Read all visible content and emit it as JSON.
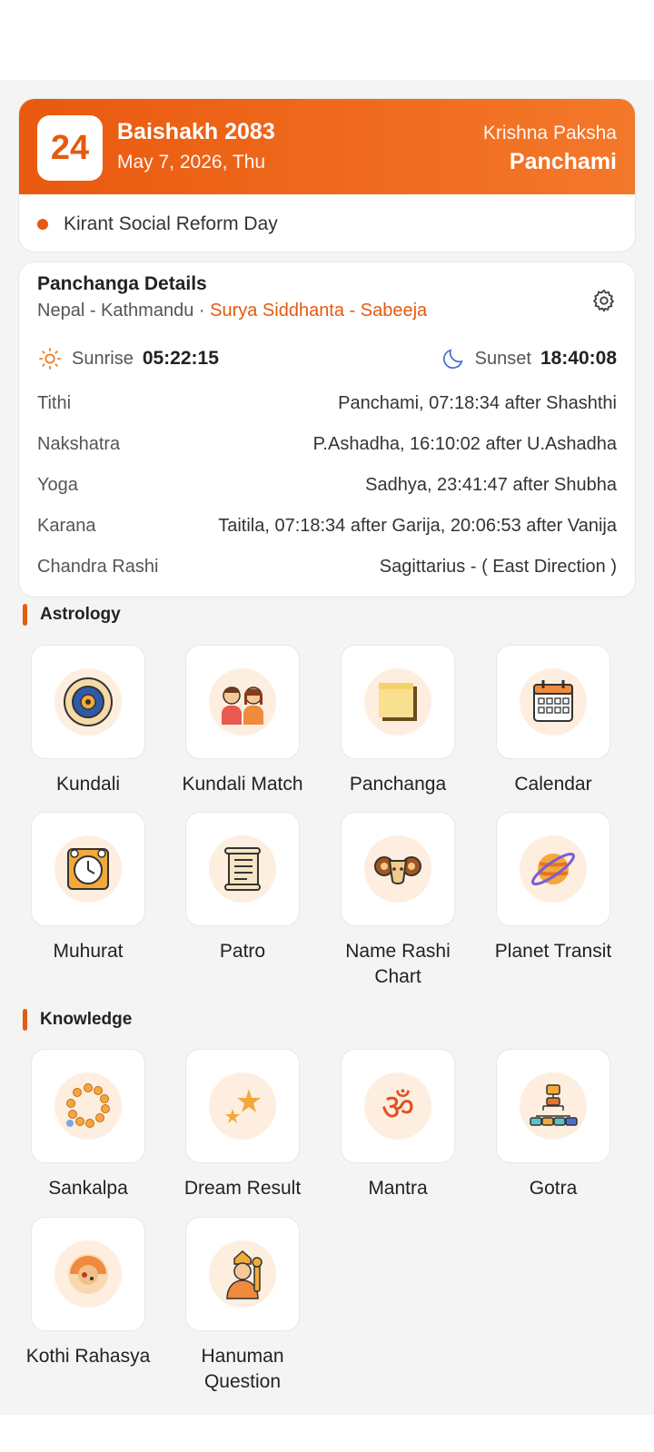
{
  "date_card": {
    "day": "24",
    "month_year": "Baishakh 2083",
    "gregorian": "May 7, 2026, Thu",
    "paksha": "Krishna Paksha",
    "tithi": "Panchami",
    "event": "Kirant Social Reform Day",
    "accent": "#e55a10"
  },
  "panchanga": {
    "title": "Panchanga Details",
    "location": "Nepal - Kathmandu",
    "separator": " · ",
    "system": "Surya Siddhanta - Sabeeja",
    "sunrise_label": "Sunrise",
    "sunrise": "05:22:15",
    "sunset_label": "Sunset",
    "sunset": "18:40:08",
    "rows": [
      {
        "label": "Tithi",
        "value": "Panchami, 07:18:34 after Shashthi"
      },
      {
        "label": "Nakshatra",
        "value": "P.Ashadha, 16:10:02 after U.Ashadha"
      },
      {
        "label": "Yoga",
        "value": "Sadhya, 23:41:47 after Shubha"
      },
      {
        "label": "Karana",
        "value": "Taitila, 07:18:34 after Garija, 20:06:53 after Vanija"
      },
      {
        "label": "Chandra Rashi",
        "value": "Sagittarius - ( East Direction )"
      }
    ]
  },
  "astrology": {
    "title": "Astrology",
    "items": [
      {
        "label": "Kundali",
        "icon": "zodiac-wheel-icon"
      },
      {
        "label": "Kundali Match",
        "icon": "couple-icon"
      },
      {
        "label": "Panchanga",
        "icon": "sticky-note-icon"
      },
      {
        "label": "Calendar",
        "icon": "calendar-icon"
      },
      {
        "label": "Muhurat",
        "icon": "alarm-clock-icon"
      },
      {
        "label": "Patro",
        "icon": "scroll-icon"
      },
      {
        "label": "Name Rashi Chart",
        "icon": "ram-icon"
      },
      {
        "label": "Planet Transit",
        "icon": "planet-icon"
      }
    ]
  },
  "knowledge": {
    "title": "Knowledge",
    "items": [
      {
        "label": "Sankalpa",
        "icon": "prayer-beads-icon"
      },
      {
        "label": "Dream Result",
        "icon": "stars-icon"
      },
      {
        "label": "Mantra",
        "icon": "om-icon"
      },
      {
        "label": "Gotra",
        "icon": "family-tree-icon"
      },
      {
        "label": "Kothi Rahasya",
        "icon": "kothi-icon"
      },
      {
        "label": "Hanuman Question",
        "icon": "hanuman-icon"
      }
    ]
  }
}
